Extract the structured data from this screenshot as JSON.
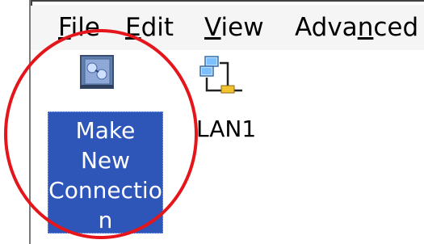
{
  "menubar": {
    "items": [
      {
        "label_pre": "",
        "label_ul": "F",
        "label_post": "ile"
      },
      {
        "label_pre": "",
        "label_ul": "E",
        "label_post": "dit"
      },
      {
        "label_pre": "",
        "label_ul": "V",
        "label_post": "iew"
      },
      {
        "label_pre": "Adva",
        "label_ul": "n",
        "label_post": "ced"
      }
    ]
  },
  "icons": {
    "make_new": {
      "label_lines": [
        "Make",
        "New",
        "Connectio",
        "n"
      ],
      "icon": "make-new-connection-icon",
      "selected": true
    },
    "lan1": {
      "label": "LAN1",
      "icon": "network-connection-icon"
    }
  },
  "colors": {
    "selection": "#2d56b8",
    "annotation": "#e5161b"
  }
}
